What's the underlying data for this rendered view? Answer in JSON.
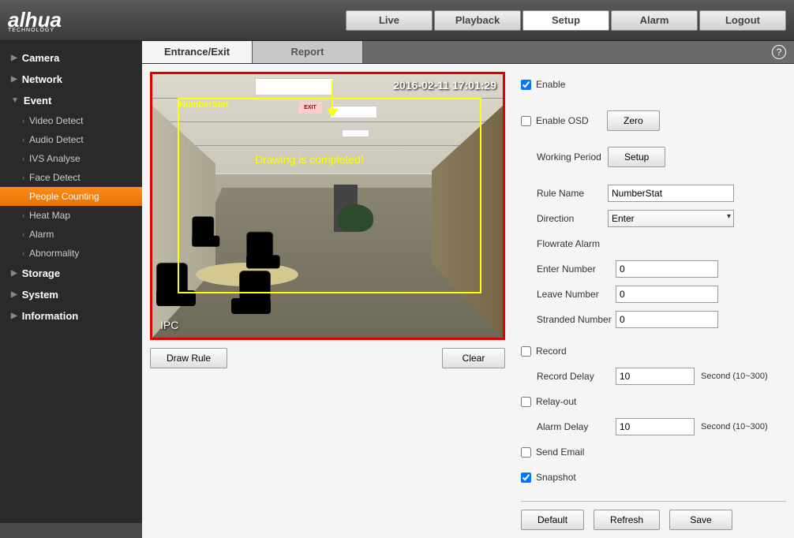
{
  "logo": {
    "brand": "alhua",
    "sub": "TECHNOLOGY"
  },
  "topTabs": [
    "Live",
    "Playback",
    "Setup",
    "Alarm",
    "Logout"
  ],
  "topTabActive": "Setup",
  "sidebar": {
    "groups": [
      {
        "label": "Camera",
        "expanded": false,
        "items": []
      },
      {
        "label": "Network",
        "expanded": false,
        "items": []
      },
      {
        "label": "Event",
        "expanded": true,
        "items": [
          "Video Detect",
          "Audio Detect",
          "IVS Analyse",
          "Face Detect",
          "People Counting",
          "Heat Map",
          "Alarm",
          "Abnormality"
        ],
        "activeItem": "People Counting"
      },
      {
        "label": "Storage",
        "expanded": false,
        "items": []
      },
      {
        "label": "System",
        "expanded": false,
        "items": []
      },
      {
        "label": "Information",
        "expanded": false,
        "items": []
      }
    ]
  },
  "subTabs": [
    "Entrance/Exit",
    "Report"
  ],
  "subTabActive": "Entrance/Exit",
  "video": {
    "timestamp": "2016-02-11 17:01:29",
    "watermark": "IPC",
    "detectLabel": "NumberStat",
    "drawingText": "Drawing is completed!",
    "exitSign": "EXIT"
  },
  "videoButtons": {
    "draw": "Draw Rule",
    "clear": "Clear"
  },
  "form": {
    "enable": {
      "label": "Enable",
      "checked": true
    },
    "enableOSD": {
      "label": "Enable OSD",
      "checked": false,
      "zeroBtn": "Zero"
    },
    "workingPeriod": {
      "label": "Working Period",
      "setupBtn": "Setup"
    },
    "ruleName": {
      "label": "Rule Name",
      "value": "NumberStat"
    },
    "direction": {
      "label": "Direction",
      "value": "Enter"
    },
    "flowrateHeader": "Flowrate Alarm",
    "enterNumber": {
      "label": "Enter Number",
      "value": "0"
    },
    "leaveNumber": {
      "label": "Leave Number",
      "value": "0"
    },
    "strandedNumber": {
      "label": "Stranded Number",
      "value": "0"
    },
    "record": {
      "label": "Record",
      "checked": false
    },
    "recordDelay": {
      "label": "Record Delay",
      "value": "10",
      "unit": "Second (10~300)"
    },
    "relayOut": {
      "label": "Relay-out",
      "checked": false
    },
    "alarmDelay": {
      "label": "Alarm Delay",
      "value": "10",
      "unit": "Second (10~300)"
    },
    "sendEmail": {
      "label": "Send Email",
      "checked": false
    },
    "snapshot": {
      "label": "Snapshot",
      "checked": true
    }
  },
  "bottomButtons": [
    "Default",
    "Refresh",
    "Save"
  ]
}
